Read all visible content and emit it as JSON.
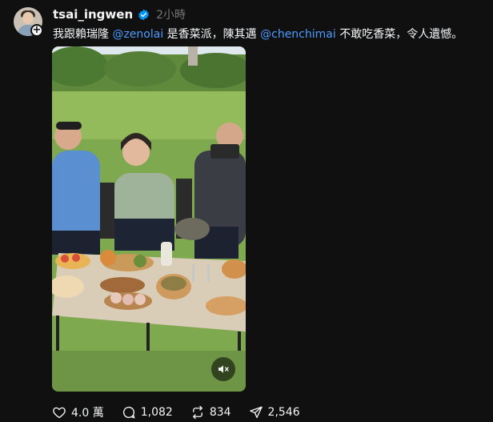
{
  "post": {
    "username": "tsai_ingwen",
    "timestamp": "2小時",
    "text_part1": "我跟賴瑞隆 ",
    "mention1": "@zenolai",
    "text_part2": " 是香菜派，陳其邁 ",
    "mention2": "@chenchimai",
    "text_part3": " 不敢吃香菜，令人遺憾。"
  },
  "actions": {
    "likes": "4.0 萬",
    "replies": "1,082",
    "reposts": "834",
    "shares": "2,546"
  },
  "colors": {
    "background": "#101010",
    "mention": "#4a9cff",
    "verified": "#0095f6"
  },
  "icons": {
    "avatar": "avatar",
    "follow": "plus-icon",
    "verified": "verified-badge-icon",
    "mute": "speaker-muted-icon",
    "like": "heart-icon",
    "reply": "comment-icon",
    "repost": "repost-icon",
    "share": "send-icon"
  }
}
